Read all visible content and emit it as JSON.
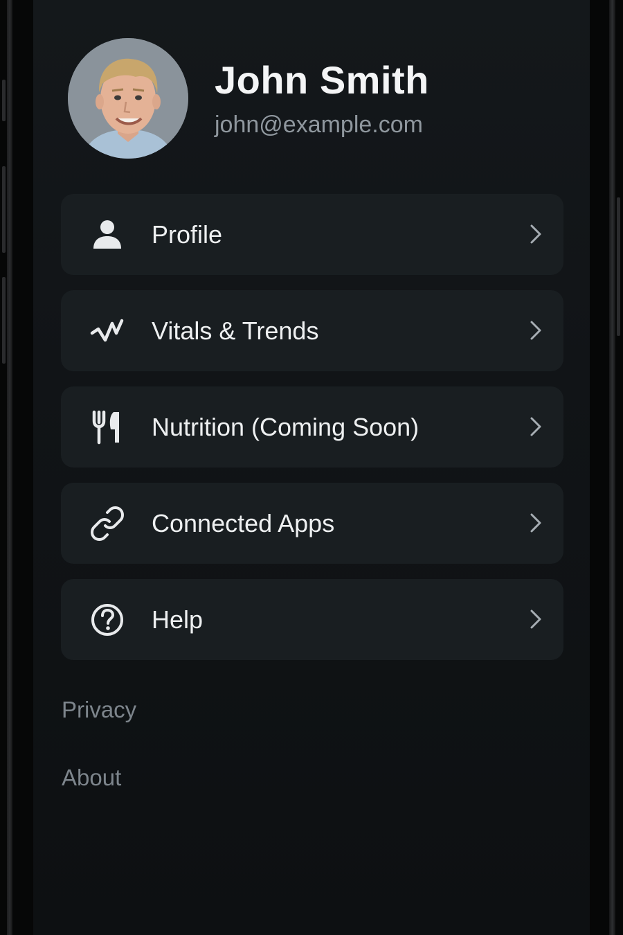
{
  "user": {
    "name": "John Smith",
    "email": "john@example.com"
  },
  "menu": {
    "items": [
      {
        "label": "Profile",
        "icon": "person-icon"
      },
      {
        "label": "Vitals & Trends",
        "icon": "activity-icon"
      },
      {
        "label": "Nutrition (Coming Soon)",
        "icon": "fork-knife-icon"
      },
      {
        "label": "Connected Apps",
        "icon": "link-icon"
      },
      {
        "label": "Help",
        "icon": "help-circle-icon"
      }
    ]
  },
  "footer": {
    "privacy": "Privacy",
    "about": "About"
  },
  "colors": {
    "background": "#111417",
    "card": "#191e21",
    "text_primary": "#eef0f1",
    "text_secondary": "#8f979e"
  }
}
